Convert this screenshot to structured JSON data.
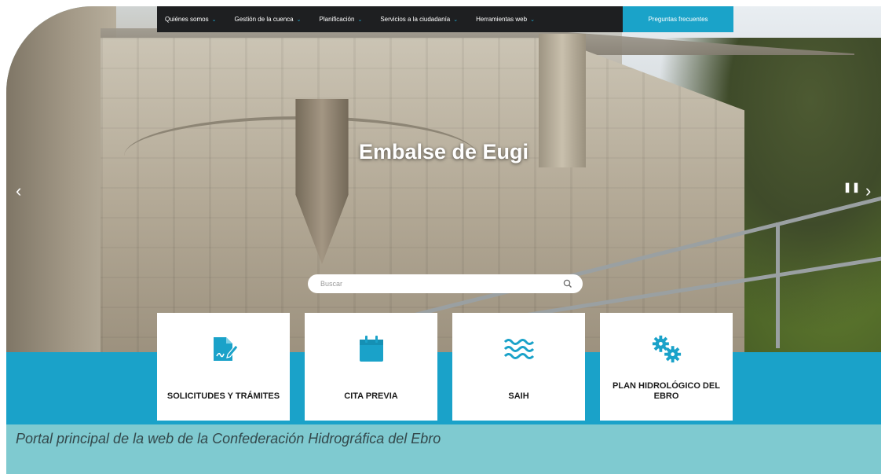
{
  "nav": {
    "items": [
      {
        "label": "Quiénes somos"
      },
      {
        "label": "Gestión de la cuenca"
      },
      {
        "label": "Planificación"
      },
      {
        "label": "Servicios a la ciudadanía"
      },
      {
        "label": "Herramientas web"
      }
    ],
    "faq_label": "Preguntas frecuentes"
  },
  "hero": {
    "title": "Embalse de Eugi"
  },
  "search": {
    "placeholder": "Buscar"
  },
  "cards": [
    {
      "label": "SOLICITUDES Y TRÁMITES",
      "icon": "document-signature-icon"
    },
    {
      "label": "CITA PREVIA",
      "icon": "calendar-icon"
    },
    {
      "label": "SAIH",
      "icon": "water-waves-icon"
    },
    {
      "label": "PLAN HIDROLÓGICO DEL EBRO",
      "icon": "gears-icon"
    }
  ],
  "caption": "Portal principal de la web de la Confederación Hidrográfica del Ebro",
  "colors": {
    "accent": "#1aa2c9",
    "nav_bg": "#1e1f21",
    "caption_bg": "#7fcad0"
  }
}
